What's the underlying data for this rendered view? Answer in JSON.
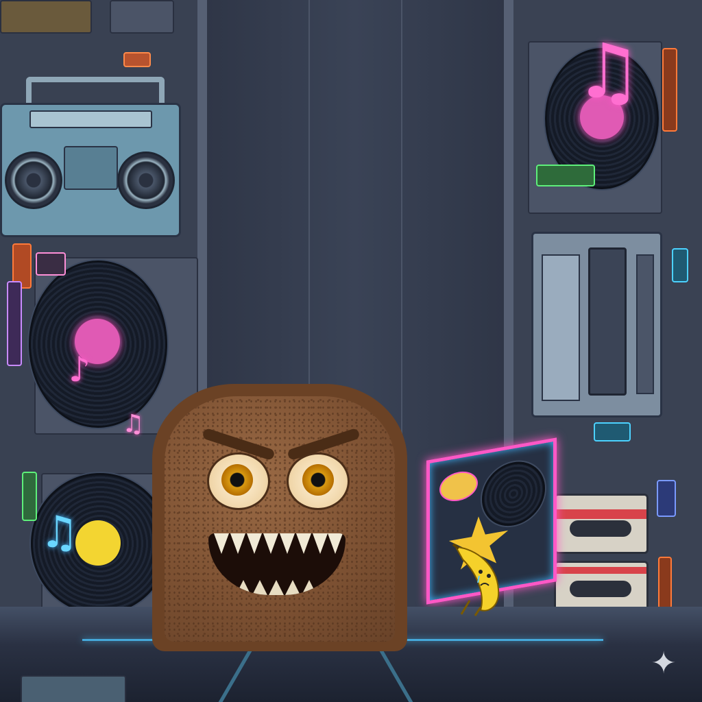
{
  "scene": {
    "background_color": "#2b3242",
    "accent_pink": "#ff58c6",
    "accent_blue": "#43b6ff",
    "accent_green": "#5ef07a",
    "accent_yellow": "#f3d531"
  },
  "characters": {
    "toast": {
      "icon": "angry-toast-icon",
      "mood": "menacing"
    },
    "banana": {
      "icon": "sad-banana-icon",
      "mood": "crying"
    }
  },
  "props": {
    "icons": [
      "boombox-icon",
      "vinyl-record-icon",
      "cassette-tape-icon",
      "tape-player-icon",
      "neon-music-note-icon",
      "billboard-icon",
      "sparkle-icon"
    ]
  },
  "glyphs": {
    "note_double": "♫",
    "note_single": "♪",
    "sparkle": "✦"
  }
}
